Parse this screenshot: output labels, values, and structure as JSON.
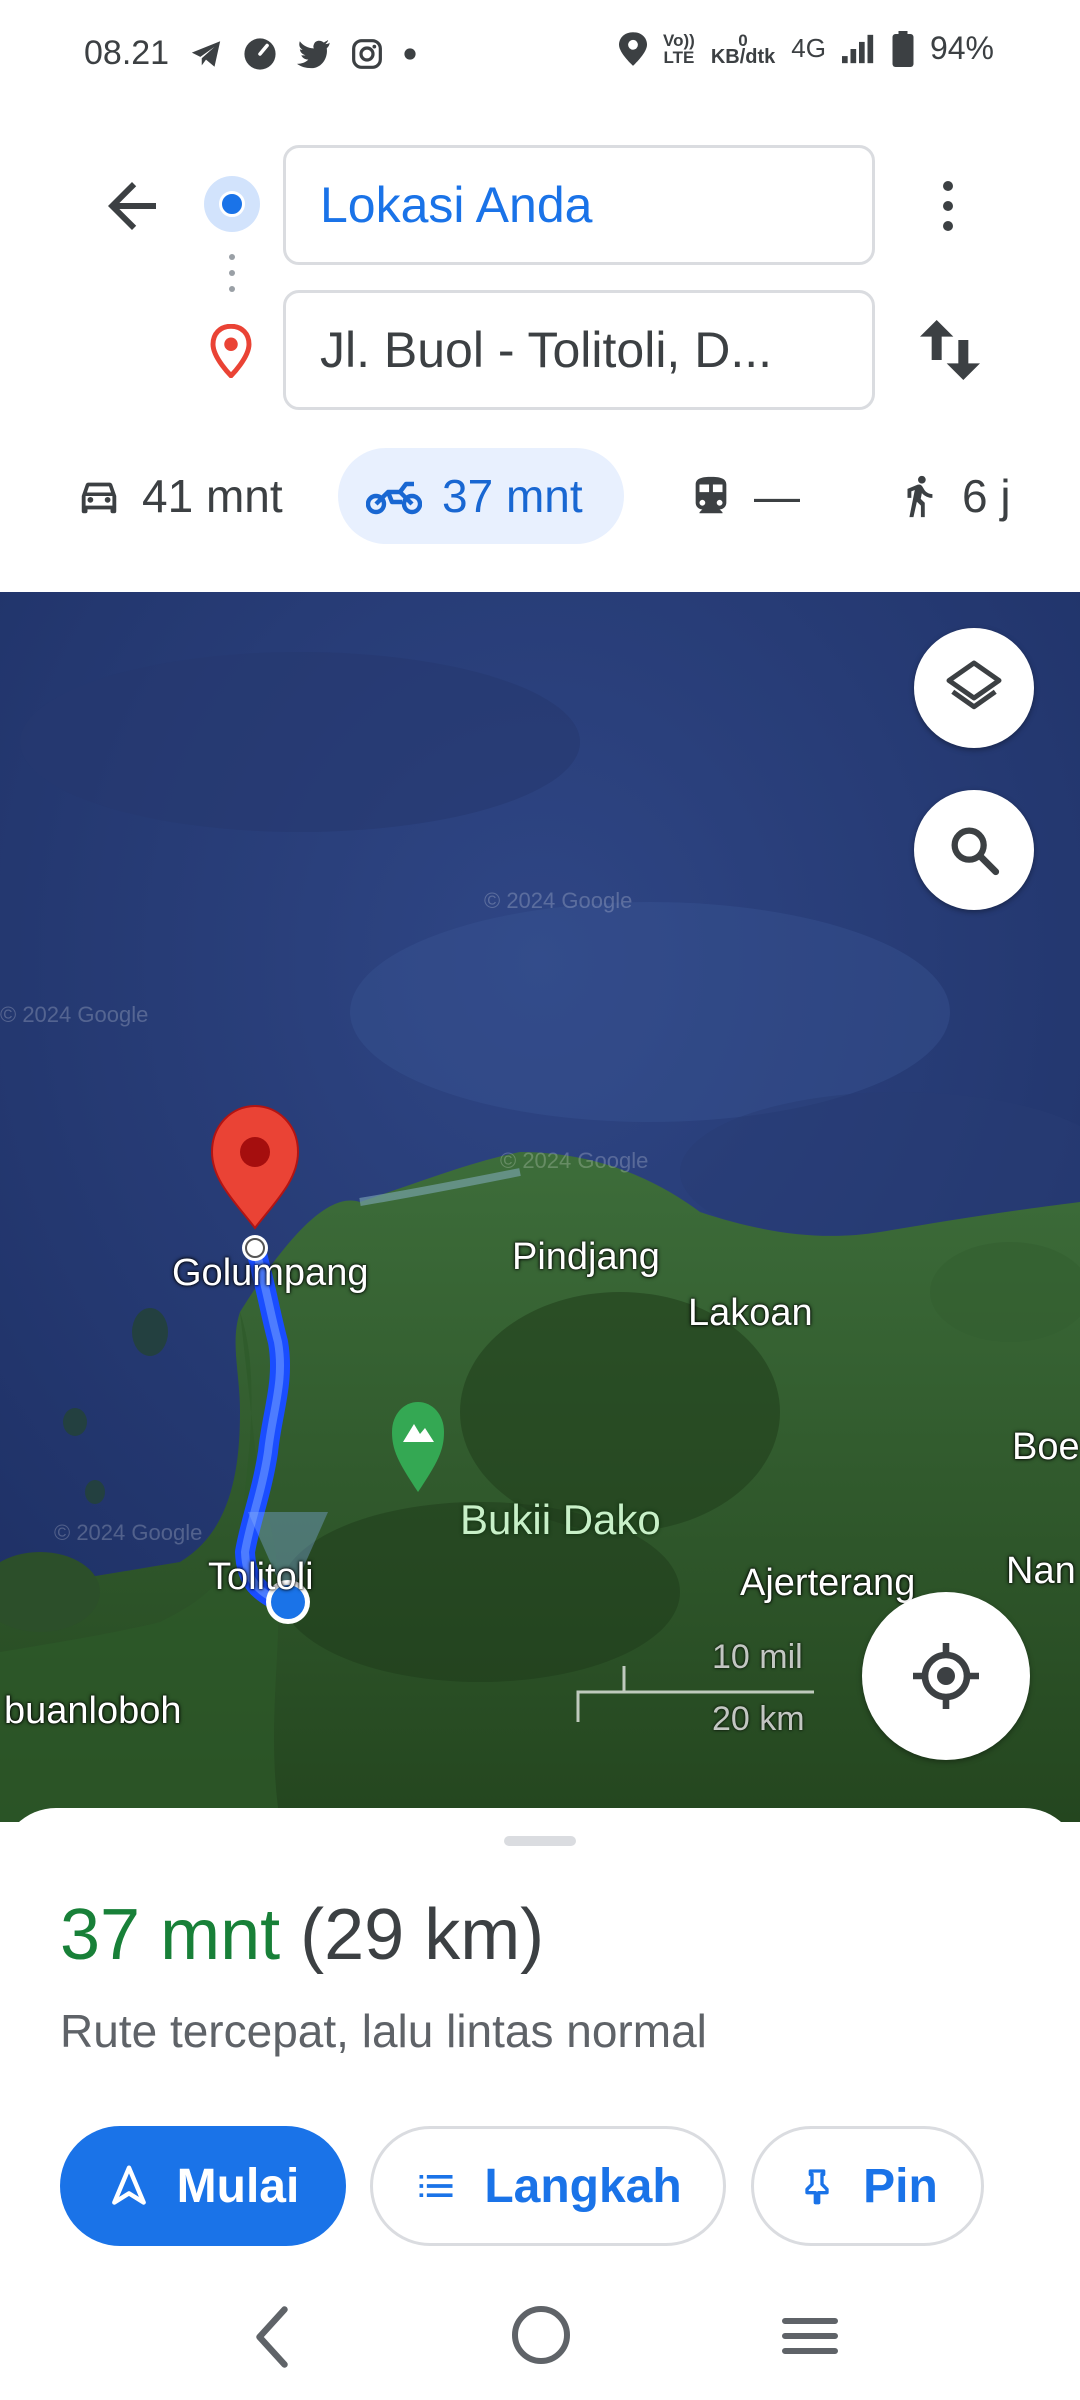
{
  "status_bar": {
    "time": "08.21",
    "network_speed_value": "0",
    "network_speed_unit": "KB/dtk",
    "network_type": "4G",
    "battery": "94%",
    "volte_line1": "Vo))",
    "volte_line2": "LTE",
    "notification_icons": [
      "telegram-icon",
      "speedometer-icon",
      "twitter-icon",
      "instagram-icon",
      "dot-icon"
    ]
  },
  "directions": {
    "origin": "Lokasi Anda",
    "destination": "Jl. Buol - Tolitoli, D..."
  },
  "travel_modes": [
    {
      "mode": "car",
      "label": "41 mnt",
      "icon": "car-icon"
    },
    {
      "mode": "motorcycle",
      "label": "37 mnt",
      "icon": "motorcycle-icon",
      "selected": true
    },
    {
      "mode": "transit",
      "label": "—",
      "icon": "train-icon"
    },
    {
      "mode": "walk",
      "label": "6 j",
      "icon": "walking-icon"
    }
  ],
  "map": {
    "labels": {
      "golumpang": "Golumpang",
      "tolitoli": "Tolitoli",
      "pindjang": "Pindjang",
      "lakoan": "Lakoan",
      "ajerterang": "Ajerterang",
      "boe": "Boe",
      "nan": "Nan",
      "buanloboh": "buanloboh",
      "bukit_dako": "Bukii Dako"
    },
    "watermark": "© 2024 Google",
    "scale": {
      "mil": "10 mil",
      "km": "20 km"
    },
    "colors": {
      "route": "#1a4dff",
      "pin": "#ea4335",
      "sea": "#2a3f7a",
      "land": "#2d5a2a"
    }
  },
  "route_summary": {
    "duration": "37 mnt",
    "distance": "(29 km)",
    "description": "Rute tercepat, lalu lintas normal"
  },
  "actions": {
    "start": "Mulai",
    "steps": "Langkah",
    "pin": "Pin"
  },
  "colors": {
    "accent": "#1a73e8",
    "duration_green": "#188038",
    "selected_mode_bg": "#e8f0fe"
  }
}
